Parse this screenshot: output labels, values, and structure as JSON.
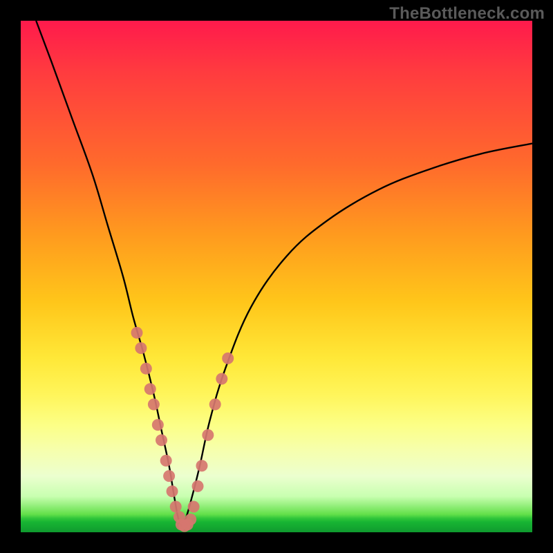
{
  "watermark": "TheBottleneck.com",
  "chart_data": {
    "type": "line",
    "title": "",
    "xlabel": "",
    "ylabel": "",
    "xlim": [
      0,
      100
    ],
    "ylim": [
      0,
      100
    ],
    "annotations": [],
    "series": [
      {
        "name": "bottleneck-curve",
        "color": "#000000",
        "x": [
          3,
          6,
          10,
          14,
          17,
          20,
          22,
          24,
          26,
          27.5,
          29,
          30,
          31,
          32,
          33.5,
          35,
          37,
          40,
          45,
          52,
          60,
          70,
          80,
          90,
          100
        ],
        "y": [
          100,
          92,
          81,
          70,
          60,
          50,
          42,
          35,
          27,
          20,
          13,
          7,
          2,
          2,
          7,
          13,
          22,
          32,
          44,
          54,
          61,
          67,
          71,
          74,
          76
        ]
      },
      {
        "name": "highlight-dots-left",
        "color": "#d6766f",
        "x": [
          22.7,
          23.5,
          24.5,
          25.3,
          26.0,
          26.8,
          27.5,
          28.4,
          29.0,
          29.6,
          30.3,
          31.0
        ],
        "y": [
          39,
          36,
          32,
          28,
          25,
          21,
          18,
          14,
          11,
          8,
          5,
          3
        ]
      },
      {
        "name": "highlight-dots-bottom",
        "color": "#d6766f",
        "x": [
          31.4,
          32.0,
          32.6,
          33.2
        ],
        "y": [
          1.5,
          1.2,
          1.5,
          2.5
        ]
      },
      {
        "name": "highlight-dots-right",
        "color": "#d6766f",
        "x": [
          33.8,
          34.6,
          35.4,
          36.6,
          38.0,
          39.3,
          40.5
        ],
        "y": [
          5,
          9,
          13,
          19,
          25,
          30,
          34
        ]
      }
    ]
  }
}
